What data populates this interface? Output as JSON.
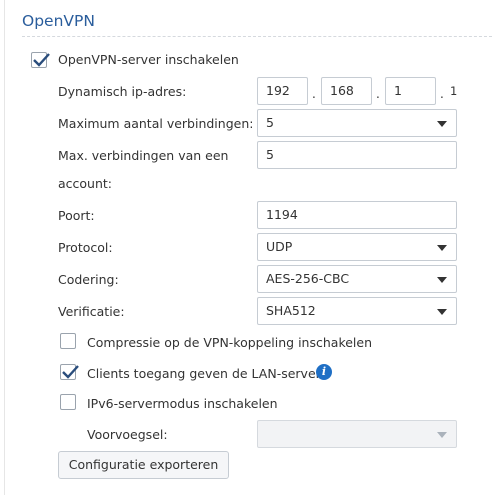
{
  "title": "OpenVPN",
  "enable_server": {
    "label": "OpenVPN-server inschakelen",
    "checked": true
  },
  "dynamic_ip": {
    "label": "Dynamisch ip-adres:",
    "octet1": "192",
    "octet2": "168",
    "octet3": "1",
    "octet4": "1",
    "separator": "."
  },
  "max_connections": {
    "label": "Maximum aantal verbindingen:",
    "value": "5"
  },
  "max_per_account": {
    "label_line1": "Max. verbindingen van een",
    "label_line2": "account:",
    "value": "5"
  },
  "port": {
    "label": "Poort:",
    "value": "1194"
  },
  "protocol": {
    "label": "Protocol:",
    "value": "UDP"
  },
  "encryption": {
    "label": "Codering:",
    "value": "AES-256-CBC"
  },
  "verification": {
    "label": "Verificatie:",
    "value": "SHA512"
  },
  "compression": {
    "label": "Compressie op de VPN-koppeling inschakelen",
    "checked": false
  },
  "lan_access": {
    "label": "Clients toegang geven de LAN-server",
    "checked": true
  },
  "ipv6": {
    "label": "IPv6-servermodus inschakelen",
    "checked": false
  },
  "prefix": {
    "label": "Voorvoegsel:",
    "value": ""
  },
  "export_button": "Configuratie exporteren",
  "info_glyph": "i",
  "colors": {
    "title": "#2a5d9c",
    "info": "#1f6fc5"
  }
}
